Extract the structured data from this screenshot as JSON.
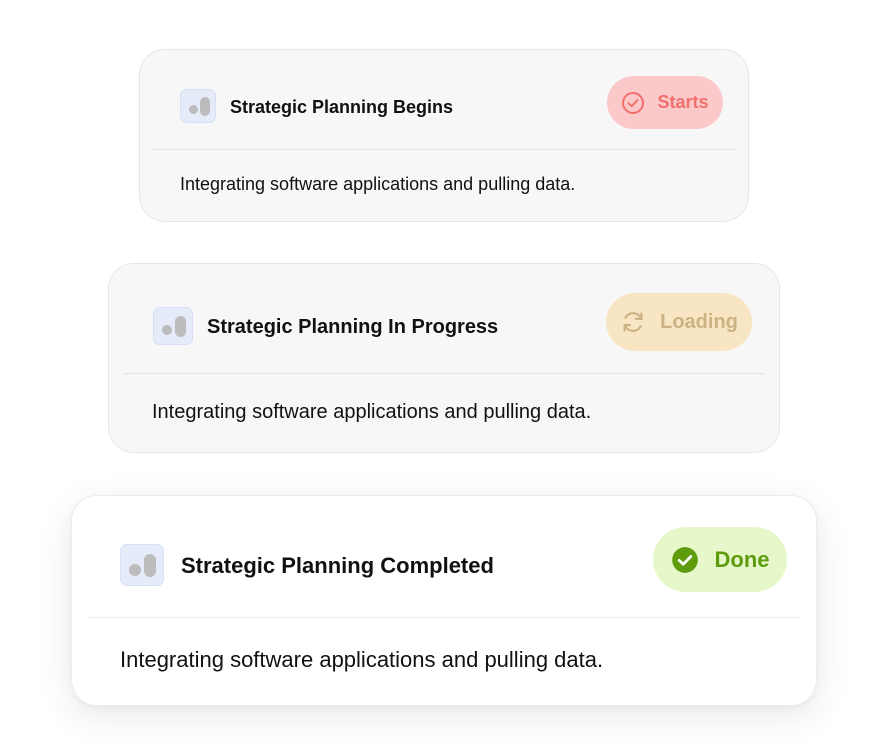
{
  "cards": [
    {
      "title": "Strategic Planning Begins",
      "status": {
        "label": "Starts",
        "icon": "check-circle-outline-icon",
        "color": "#f0706d",
        "background": "#fbc9c9"
      },
      "description": "Integrating software applications and pulling data."
    },
    {
      "title": "Strategic Planning In Progress",
      "status": {
        "label": "Loading",
        "icon": "refresh-icon",
        "color": "#cbb283",
        "background": "#f7e5c4"
      },
      "description": "Integrating software applications and pulling data."
    },
    {
      "title": "Strategic Planning Completed",
      "status": {
        "label": "Done",
        "icon": "check-circle-filled-icon",
        "color": "#5e9c0e",
        "background": "#e6f8c9"
      },
      "description": "Integrating software applications and pulling data."
    }
  ],
  "colors": {
    "app_icon_bg": "#e6ebf9",
    "app_icon_glyph": "#bcbcbc",
    "card_bg": "#f7f7f7",
    "active_card_bg": "#ffffff"
  }
}
